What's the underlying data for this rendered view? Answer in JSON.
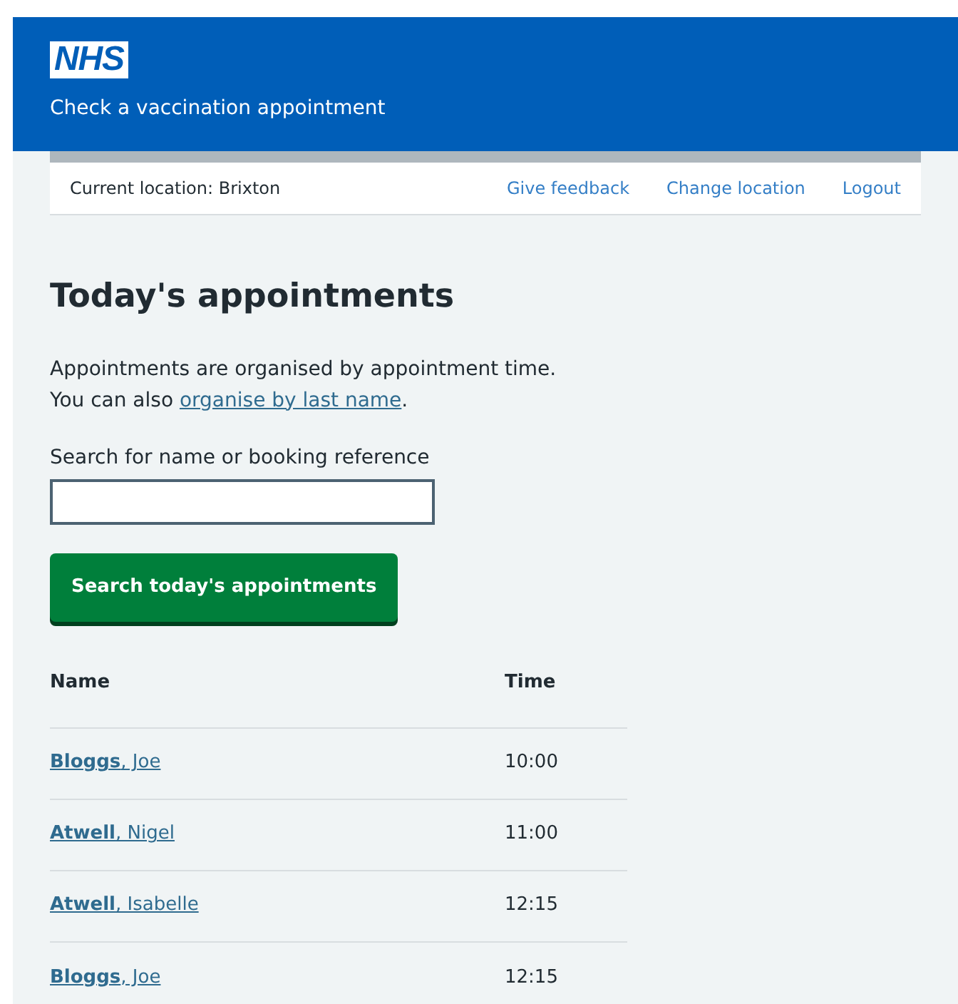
{
  "header": {
    "logo": "NHS",
    "service_name": "Check a vaccination appointment"
  },
  "nav": {
    "location": "Current location: Brixton",
    "links": [
      "Give feedback",
      "Change location",
      "Logout"
    ]
  },
  "page": {
    "title": "Today's appointments",
    "intro_line_1": "Appointments are organised by appointment time.",
    "intro_line_2_prefix": "You can also ",
    "intro_link": "organise by last name",
    "intro_line_2_suffix": "."
  },
  "search": {
    "label": "Search for name or booking reference",
    "button": "Search today's appointments"
  },
  "table": {
    "columns": [
      "Name",
      "Time"
    ],
    "rows": [
      {
        "name": "**Bloggs**, Joe",
        "time": "10:00"
      },
      {
        "name": "**Atwell**, Nigel",
        "time": "11:00"
      },
      {
        "name": "**Atwell**, Isabelle",
        "time": "12:15"
      },
      {
        "name": "**Bloggs**, Joe",
        "time": "12:15"
      }
    ]
  }
}
